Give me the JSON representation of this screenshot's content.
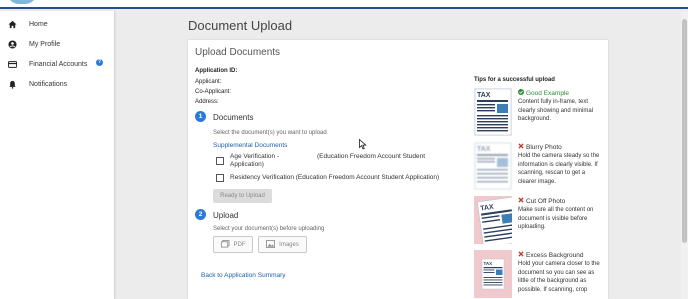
{
  "sidebar": {
    "items": [
      {
        "label": "Home",
        "icon": "home-icon"
      },
      {
        "label": "My Profile",
        "icon": "user-icon"
      },
      {
        "label": "Financial Accounts",
        "icon": "card-icon",
        "badge": "?"
      },
      {
        "label": "Notifications",
        "icon": "bell-icon"
      }
    ]
  },
  "page": {
    "title": "Document Upload"
  },
  "card": {
    "title": "Upload Documents",
    "application_id_label": "Application ID:",
    "applicant_label": "Applicant:",
    "co_applicant_label": "Co-Applicant:",
    "address_label": "Address:",
    "step1": {
      "number": "1",
      "title": "Documents",
      "hint": "Select the document(s) you want to upload",
      "link": "Supplemental Documents",
      "documents": [
        {
          "name": "Age Verification -\nApplication)",
          "program": "(Education Freedom Account Student",
          "checked": false
        },
        {
          "name": "Residency Verification (Education Freedom Account Student Application)",
          "checked": false
        }
      ],
      "ready_button": "Ready to Upload"
    },
    "step2": {
      "number": "2",
      "title": "Upload",
      "hint": "Select your document(s) before uploading",
      "pdf_button": "PDF",
      "images_button": "Images"
    },
    "back_link": "Back to Application Summary",
    "tips": {
      "title": "Tips for a successful upload",
      "items": [
        {
          "title": "Good Example",
          "status": "good",
          "desc": "Content fully in-frame, text clearly showing and minimal background."
        },
        {
          "title": "Blurry Photo",
          "status": "bad",
          "desc": "Hold the camera steady so the information is clearly visible. If scanning, rescan to get a clearer image."
        },
        {
          "title": "Cut Off Photo",
          "status": "bad",
          "desc": "Make sure all the content on document is visible before uploading."
        },
        {
          "title": "Excess Background",
          "status": "bad",
          "desc": "Hold your camera closer to the document so you can see as little of the background as possible. If scanning, crop"
        }
      ],
      "thumb_text": "TAX"
    }
  },
  "colors": {
    "accent": "#2a7bd5",
    "link": "#1f5fa8",
    "good": "#2e8b3a",
    "bad": "#c0392b",
    "header_border": "#1f4f8f"
  }
}
